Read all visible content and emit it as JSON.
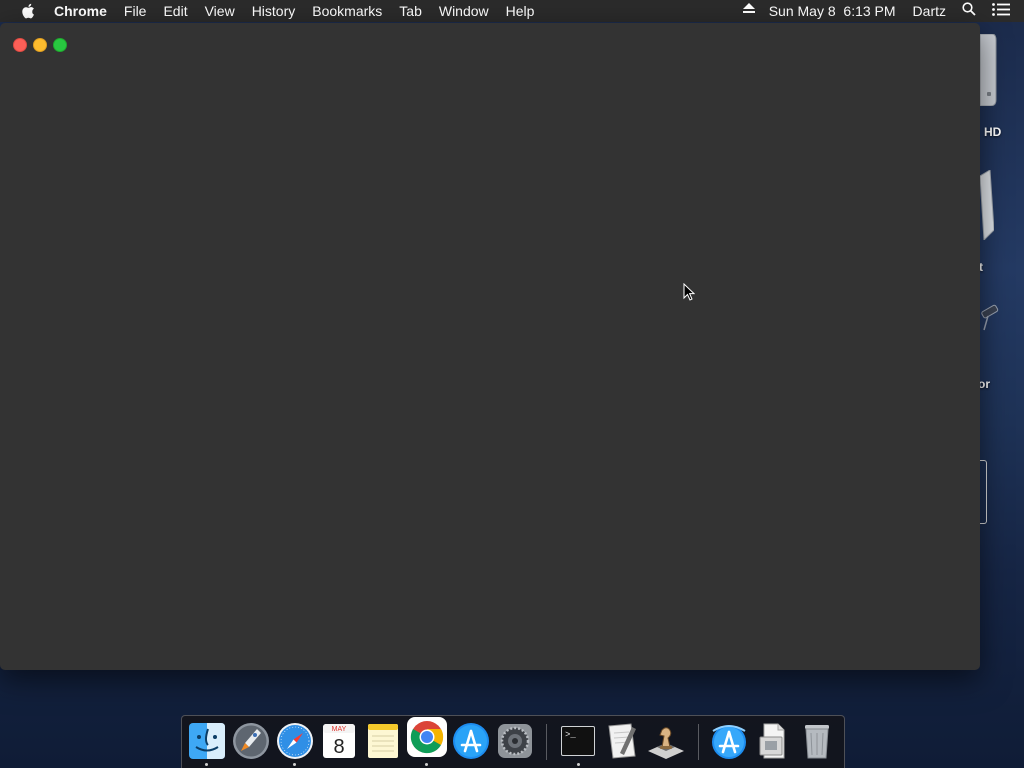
{
  "menubar": {
    "app_name": "Chrome",
    "menus": [
      "File",
      "Edit",
      "View",
      "History",
      "Bookmarks",
      "Tab",
      "Window",
      "Help"
    ],
    "clock": "Sun May 8  6:13 PM",
    "user": "Dartz",
    "icons": [
      "apple-icon",
      "eject-icon",
      "spotlight-search-icon",
      "notification-center-icon"
    ]
  },
  "desktop": {
    "labels": [
      "HD",
      "t",
      "or"
    ]
  },
  "window": {
    "app": "Chrome",
    "background_color": "#333333",
    "controls": [
      "close",
      "minimize",
      "zoom"
    ]
  },
  "dock": {
    "items": [
      {
        "name": "Finder",
        "icon": "finder-icon",
        "running": true
      },
      {
        "name": "Launchpad",
        "icon": "launchpad-icon",
        "running": false
      },
      {
        "name": "Safari",
        "icon": "safari-icon",
        "running": true
      },
      {
        "name": "Calendar",
        "icon": "calendar-icon",
        "running": false,
        "month": "MAY",
        "day": "8"
      },
      {
        "name": "Notes",
        "icon": "notes-icon",
        "running": false
      },
      {
        "name": "Google Chrome",
        "icon": "chrome-icon",
        "running": true
      },
      {
        "name": "App Store",
        "icon": "app-store-icon",
        "running": false
      },
      {
        "name": "System Preferences",
        "icon": "system-preferences-icon",
        "running": false
      },
      {
        "name": "Terminal",
        "icon": "terminal-icon",
        "running": true,
        "prompt": ">_"
      },
      {
        "name": "Script Editor",
        "icon": "script-editor-icon",
        "running": false
      },
      {
        "name": "Chess",
        "icon": "chess-icon",
        "running": false
      },
      {
        "name": "Applications",
        "icon": "applications-folder-icon",
        "running": false
      },
      {
        "name": "Downloads",
        "icon": "downloads-stack-icon",
        "running": false
      },
      {
        "name": "Trash",
        "icon": "trash-icon",
        "running": false
      }
    ]
  }
}
